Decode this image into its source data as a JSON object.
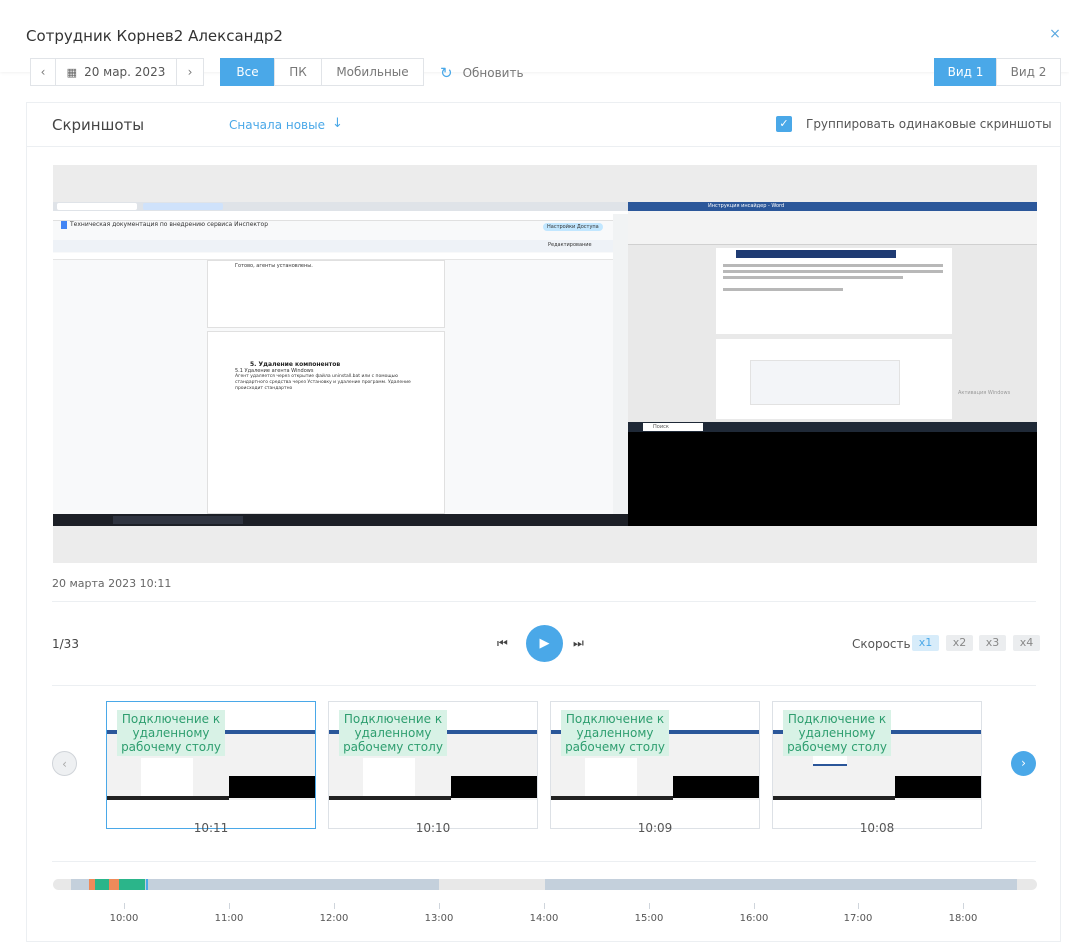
{
  "header": {
    "title": "Сотрудник Корнев2 Александр2",
    "close_label": "×"
  },
  "toolbar": {
    "prev_label": "‹",
    "date_label": "20 мар. 2023",
    "next_label": "›",
    "filter_all": "Все",
    "filter_pc": "ПК",
    "filter_mobile": "Мобильные",
    "refresh_label": "Обновить",
    "view1": "Вид 1",
    "view2": "Вид 2"
  },
  "panel": {
    "title": "Скриншоты",
    "sort_label": "Сначала новые",
    "sort_arrow": "↓",
    "group_label": "Группировать одинаковые скриншоты",
    "group_checked": true,
    "screenshot_timestamp": "20 марта 2023 10:11"
  },
  "player": {
    "counter": "1/33",
    "prev_label": "⏮",
    "play_label": "▶",
    "next_label": "⏭",
    "speed_label": "Скорость:",
    "speeds": [
      "x1",
      "x2",
      "x3",
      "x4"
    ],
    "active_speed": "x1"
  },
  "thumbnails": [
    {
      "badge": "Подключение к удаленному рабочему столу",
      "time": "10:11",
      "active": true
    },
    {
      "badge": "Подключение к удаленному рабочему столу",
      "time": "10:10",
      "active": false
    },
    {
      "badge": "Подключение к удаленному рабочему столу",
      "time": "10:09",
      "active": false
    },
    {
      "badge": "Подключение к удаленному рабочему столу",
      "time": "10:08",
      "active": false
    }
  ],
  "timeline": {
    "ticks": [
      "10:00",
      "11:00",
      "12:00",
      "13:00",
      "14:00",
      "15:00",
      "16:00",
      "17:00",
      "18:00"
    ]
  },
  "screenshot_content": {
    "doc_title": "Техническая документация по внедрению сервиса Инспектор",
    "doc_line1": "Готово, агенты установлены.",
    "doc_heading": "5. Удаление компонентов",
    "doc_sub": "5.1 Удаление агента Windows",
    "doc_body": "Агент удаляется через открытие файла uninstall.bat или с помощью стандартного средства через Установку и удаление программ. Удаление происходит стандартно",
    "share_button": "Настройки Доступа",
    "edit_mode": "Редактирование",
    "word_title": "Инструкция инсайдер - Word",
    "win_activation": "Активация Windows",
    "search_placeholder": "Поиск"
  },
  "colors": {
    "accent": "#4aa8e8",
    "badge_bg": "#d8f2e6",
    "badge_text": "#2e9e6f",
    "timeline_active": "#c4d0dc",
    "timeline_green": "#2bb58a",
    "timeline_orange": "#ef8a5a"
  }
}
